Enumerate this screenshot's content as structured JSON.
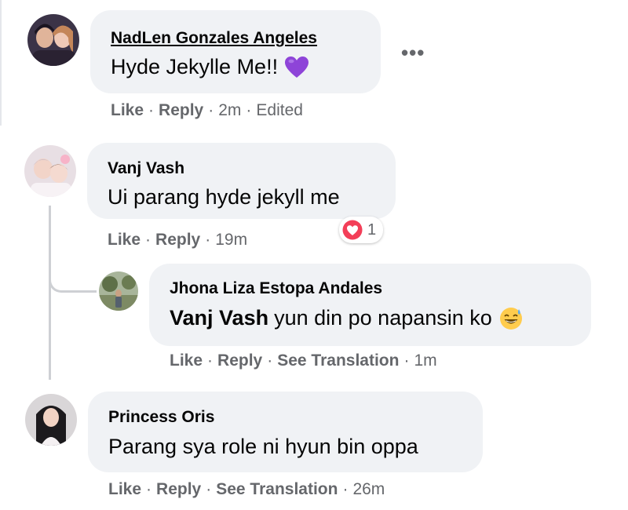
{
  "comments": [
    {
      "author": "NadLen Gonzales Angeles",
      "text": "Hyde Jekylle Me!!",
      "emoji_icon": "purple-heart-icon",
      "actions": {
        "like": "Like",
        "reply": "Reply",
        "time": "2m",
        "edited": "Edited"
      }
    },
    {
      "author": "Vanj Vash",
      "text": "Ui parang hyde jekyll me",
      "reaction": {
        "icon": "love-reaction-icon",
        "count": "1"
      },
      "actions": {
        "like": "Like",
        "reply": "Reply",
        "time": "19m"
      },
      "replies": [
        {
          "author": "Jhona Liza Estopa Andales",
          "mention": "Vanj Vash",
          "text": "yun din po napansin ko",
          "emoji_icon": "grinning-sweat-icon",
          "actions": {
            "like": "Like",
            "reply": "Reply",
            "translate": "See Translation",
            "time": "1m"
          }
        }
      ]
    },
    {
      "author": "Princess Oris",
      "text": "Parang sya role ni hyun bin oppa",
      "actions": {
        "like": "Like",
        "reply": "Reply",
        "translate": "See Translation",
        "time": "26m"
      }
    }
  ],
  "more_options": "•••",
  "separator": "·",
  "colors": {
    "bubble": "#f0f2f5",
    "meta": "#65676b",
    "text": "#050505",
    "love": "#f33e58",
    "purple": "#8e44d8"
  }
}
